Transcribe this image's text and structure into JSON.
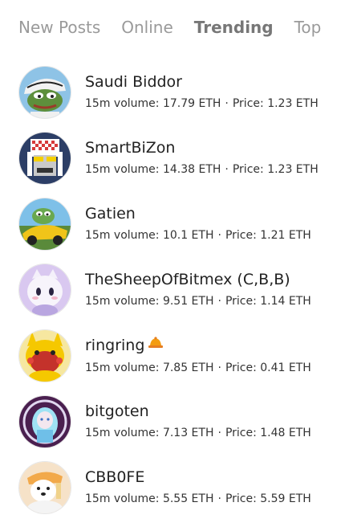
{
  "tabs": [
    {
      "label": "New Posts",
      "active": false
    },
    {
      "label": "Online",
      "active": false
    },
    {
      "label": "Trending",
      "active": true
    },
    {
      "label": "Top",
      "active": false
    }
  ],
  "stats_labels": {
    "volume_prefix": "15m volume:",
    "price_prefix": "Price:",
    "separator": "·"
  },
  "users": [
    {
      "name": "Saudi Biddor",
      "volume": "17.79 ETH",
      "price": "1.23 ETH",
      "avatar_icon": "frog-headscarf-avatar"
    },
    {
      "name": "SmartBiZon",
      "volume": "14.38 ETH",
      "price": "1.23 ETH",
      "avatar_icon": "pixel-headscarf-avatar"
    },
    {
      "name": "Gatien",
      "volume": "10.1 ETH",
      "price": "1.21 ETH",
      "avatar_icon": "frog-car-avatar"
    },
    {
      "name": "TheSheepOfBitmex (C,B,B)",
      "volume": "9.51 ETH",
      "price": "1.14 ETH",
      "avatar_icon": "cat-mascot-avatar"
    },
    {
      "name": "ringring",
      "volume": "7.85 ETH",
      "price": "0.41 ETH",
      "avatar_icon": "pikachu-avatar",
      "badge_icon": "bell-icon"
    },
    {
      "name": "bitgoten",
      "volume": "7.13 ETH",
      "price": "1.48 ETH",
      "avatar_icon": "anime-girl-avatar"
    },
    {
      "name": "CBB0FE",
      "volume": "5.55 ETH",
      "price": "5.59 ETH",
      "avatar_icon": "polar-bear-avatar"
    }
  ]
}
